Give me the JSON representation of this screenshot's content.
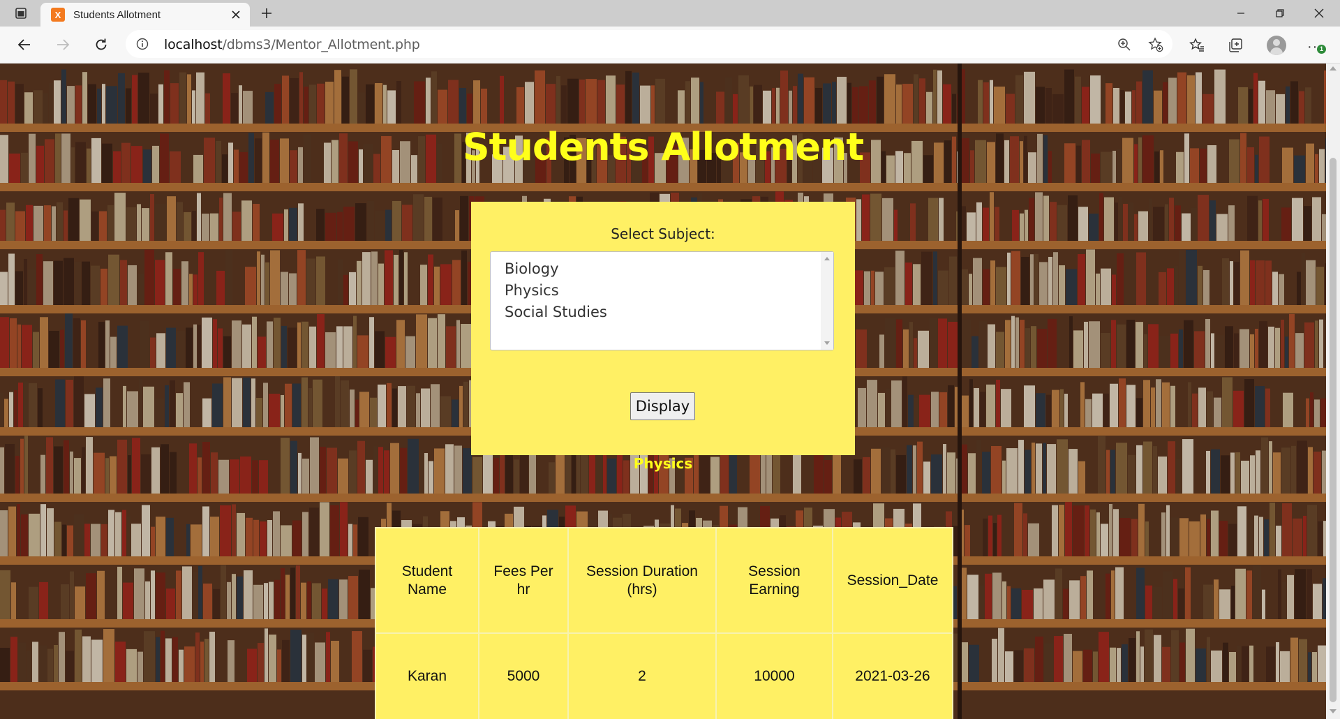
{
  "browser": {
    "tab_title": "Students Allotment",
    "favicon_text": "X",
    "url_host": "localhost",
    "url_path": "/dbms3/Mentor_Allotment.php",
    "more_badge": "1"
  },
  "page": {
    "title": "Students Allotment",
    "form": {
      "label": "Select Subject:",
      "options": [
        "Biology",
        "Physics",
        "Social Studies"
      ],
      "button_label": "Display"
    },
    "selected_subject": "Physics",
    "table": {
      "headers": [
        [
          "Student",
          "Name"
        ],
        [
          "Fees Per",
          "hr"
        ],
        [
          "Session Duration",
          "(hrs)"
        ],
        [
          "Session",
          "Earning"
        ],
        [
          "Session_Date"
        ]
      ],
      "rows": [
        [
          "Karan",
          "5000",
          "2",
          "10000",
          "2021-03-26"
        ]
      ]
    }
  },
  "colors": {
    "title_yellow": "#ffff1a",
    "panel_yellow": "#fff064",
    "favicon_orange": "#f37a1f"
  }
}
